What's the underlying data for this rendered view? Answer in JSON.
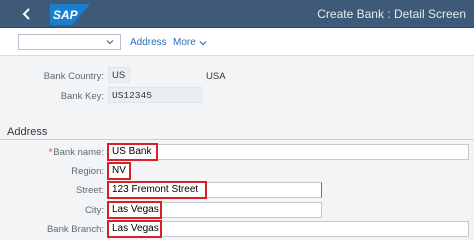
{
  "header": {
    "logo_text": "SAP",
    "title": "Create Bank : Detail Screen",
    "colors": {
      "bar": "#3e5a78",
      "logo": "#1a7fd0"
    }
  },
  "toolbar": {
    "combo_value": "",
    "address_label": "Address",
    "more_label": "More"
  },
  "general": {
    "bank_country_label": "Bank Country:",
    "bank_country_value": "US",
    "bank_country_name": "USA",
    "bank_key_label": "Bank Key:",
    "bank_key_value": "US12345"
  },
  "address": {
    "section_title": "Address",
    "required_marker": "*",
    "bank_name_label": "Bank name:",
    "bank_name_value": "US Bank",
    "region_label": "Region:",
    "region_value": "NV",
    "street_label": "Street:",
    "street_value": "123 Fremont Street",
    "city_label": "City:",
    "city_value": "Las Vegas",
    "bank_branch_label": "Bank Branch:",
    "bank_branch_value": "Las Vegas",
    "highlight_color": "#d6202a"
  }
}
